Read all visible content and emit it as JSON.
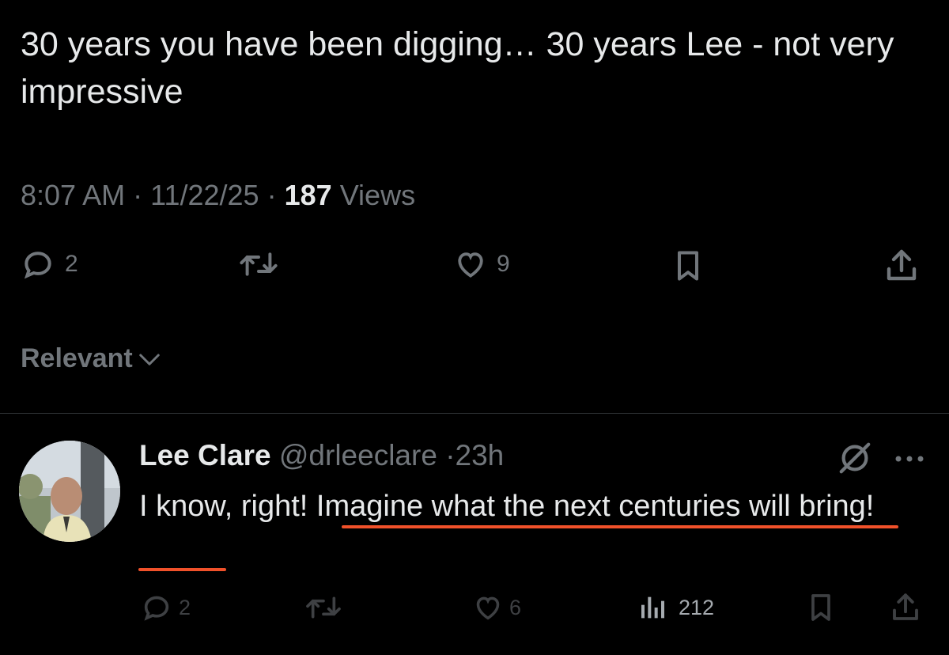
{
  "tweet": {
    "text": "30 years you have been digging… 30 years Lee - not very impressive",
    "time": "8:07 AM",
    "date": "11/22/25",
    "views_count": "187",
    "views_label": "Views",
    "reply_count": "2",
    "like_count": "9"
  },
  "sort": {
    "label": "Relevant"
  },
  "reply": {
    "name": "Lee Clare",
    "handle": "@drleeclare",
    "time": "23h",
    "text_part1": "I know, right! ",
    "text_part2": "Imagine what the next centuries will bring!",
    "reply_count": "2",
    "like_count": "6",
    "views_count": "212"
  },
  "colors": {
    "background": "#000000",
    "text": "#e7e9ea",
    "muted": "#71767b",
    "underline": "#f0512a",
    "divider": "#2f3336"
  },
  "icons": [
    "reply-icon",
    "retweet-icon",
    "heart-icon",
    "bookmark-icon",
    "share-icon",
    "chevron-down-icon",
    "grok-icon",
    "more-icon",
    "views-icon"
  ]
}
